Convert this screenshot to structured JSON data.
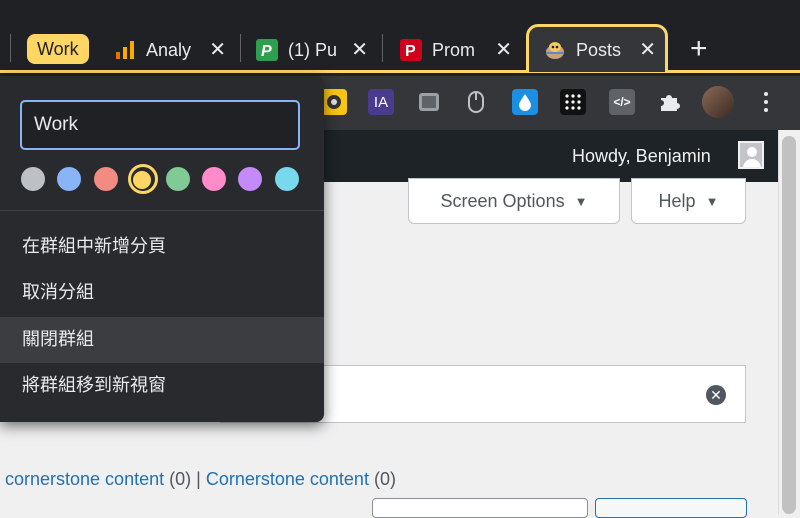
{
  "tab_group": {
    "chip_label": "Work",
    "color": "#fdd663"
  },
  "tabs": [
    {
      "title": "Analy",
      "favicon": "analytics-icon",
      "close": "✕"
    },
    {
      "title": "(1) Pu",
      "favicon": "p-green-icon",
      "close": "✕"
    },
    {
      "title": "Prom",
      "favicon": "p-red-icon",
      "close": "✕"
    },
    {
      "title": "Posts",
      "favicon": "bird-icon",
      "close": "✕",
      "active": true
    }
  ],
  "new_tab_label": "+",
  "extensions": [
    {
      "name": "tracker-extension-icon",
      "label": ""
    },
    {
      "name": "ia-extension-icon",
      "label": "IA"
    },
    {
      "name": "window-extension-icon",
      "label": ""
    },
    {
      "name": "mouse-extension-icon",
      "label": ""
    },
    {
      "name": "drop-extension-icon",
      "label": ""
    },
    {
      "name": "grid-extension-icon",
      "label": ""
    },
    {
      "name": "code-extension-icon",
      "label": "</>"
    },
    {
      "name": "puzzle-extensions-icon",
      "label": ""
    }
  ],
  "admin_bar": {
    "greeting": "Howdy, Benjamin"
  },
  "screen_options": {
    "label": "Screen Options",
    "caret": "▼"
  },
  "help": {
    "label": "Help",
    "caret": "▼"
  },
  "notice": {
    "dismiss": "✕"
  },
  "filters": {
    "item1": "cornerstone content",
    "count1": "(0)",
    "separator": "|",
    "item2": "Cornerstone content",
    "count2": "(0)"
  },
  "popup": {
    "name_value": "Work",
    "colors": [
      {
        "name": "grey",
        "hex": "#bdc1c6"
      },
      {
        "name": "blue",
        "hex": "#8ab4f8"
      },
      {
        "name": "red",
        "hex": "#f28b82"
      },
      {
        "name": "yellow",
        "hex": "#fdd663",
        "selected": true
      },
      {
        "name": "green",
        "hex": "#81c995"
      },
      {
        "name": "pink",
        "hex": "#ff8bcb"
      },
      {
        "name": "purple",
        "hex": "#c58af9"
      },
      {
        "name": "cyan",
        "hex": "#78d9ec"
      }
    ],
    "menu": [
      "在群組中新增分頁",
      "取消分組",
      "關閉群組",
      "將群組移到新視窗"
    ]
  }
}
